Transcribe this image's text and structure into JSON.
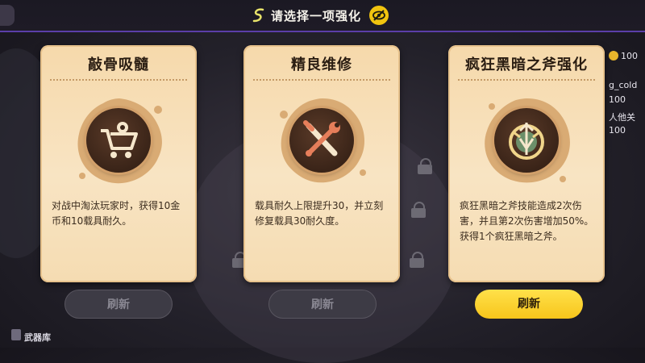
{
  "header": {
    "prompt": "请选择一项强化",
    "eye_icon": "eye-slash-icon"
  },
  "cards": [
    {
      "title": "敲骨吸髓",
      "icon": "shopping-cart-icon",
      "description": "对战中淘汰玩家时，获得10金币和10载具耐久。",
      "refresh_label": "刷新"
    },
    {
      "title": "精良维修",
      "icon": "wrench-screwdriver-icon",
      "description": "载具耐久上限提升30，并立刻修复载具30耐久度。",
      "refresh_label": "刷新"
    },
    {
      "title": "疯狂黑暗之斧强化",
      "icon": "axe-emblem-icon",
      "description": "疯狂黑暗之斧技能造成2次伤害，并且第2次伤害增加50%。获得1个疯狂黑暗之斧。",
      "refresh_label": "刷新"
    }
  ],
  "hud_right": {
    "coin_value": "100",
    "row1": "g_cold",
    "row2": "100",
    "row3": "人他关",
    "row4": "100"
  },
  "bottom_left": {
    "armory_label": "武器库"
  },
  "colors": {
    "accent_yellow": "#f7c51b",
    "top_bar_line": "#5b3ea8",
    "card_bg": "#f6d9ab"
  }
}
